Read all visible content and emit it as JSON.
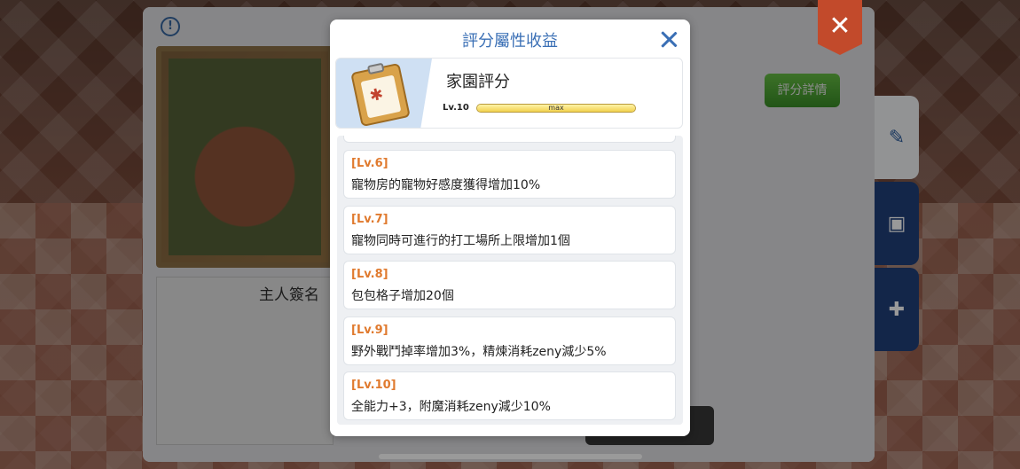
{
  "modal": {
    "title": "評分屬性收益",
    "header": {
      "name": "家園評分",
      "level": "Lv.10",
      "progress_label": "max",
      "progress_fraction": 1.0
    },
    "items": [
      {
        "level": "[Lv.6]",
        "desc": "寵物房的寵物好感度獲得增加10%"
      },
      {
        "level": "[Lv.7]",
        "desc": "寵物同時可進行的打工場所上限增加1個"
      },
      {
        "level": "[Lv.8]",
        "desc": "包包格子增加20個"
      },
      {
        "level": "[Lv.9]",
        "desc": "野外戰鬥掉率增加3%，精煉消耗zeny減少5%"
      },
      {
        "level": "[Lv.10]",
        "desc": "全能力+3，附魔消耗zeny減少10%"
      }
    ]
  },
  "background": {
    "owner_label": "主人簽名",
    "rate_details_button": "評分詳情",
    "info_icon": "info-icon",
    "close_icon": "close-icon"
  },
  "colors": {
    "title_blue": "#3a6fb5",
    "level_orange": "#e07a2e",
    "close_red": "#c24a2b",
    "tab_blue": "#1f3f7a"
  }
}
